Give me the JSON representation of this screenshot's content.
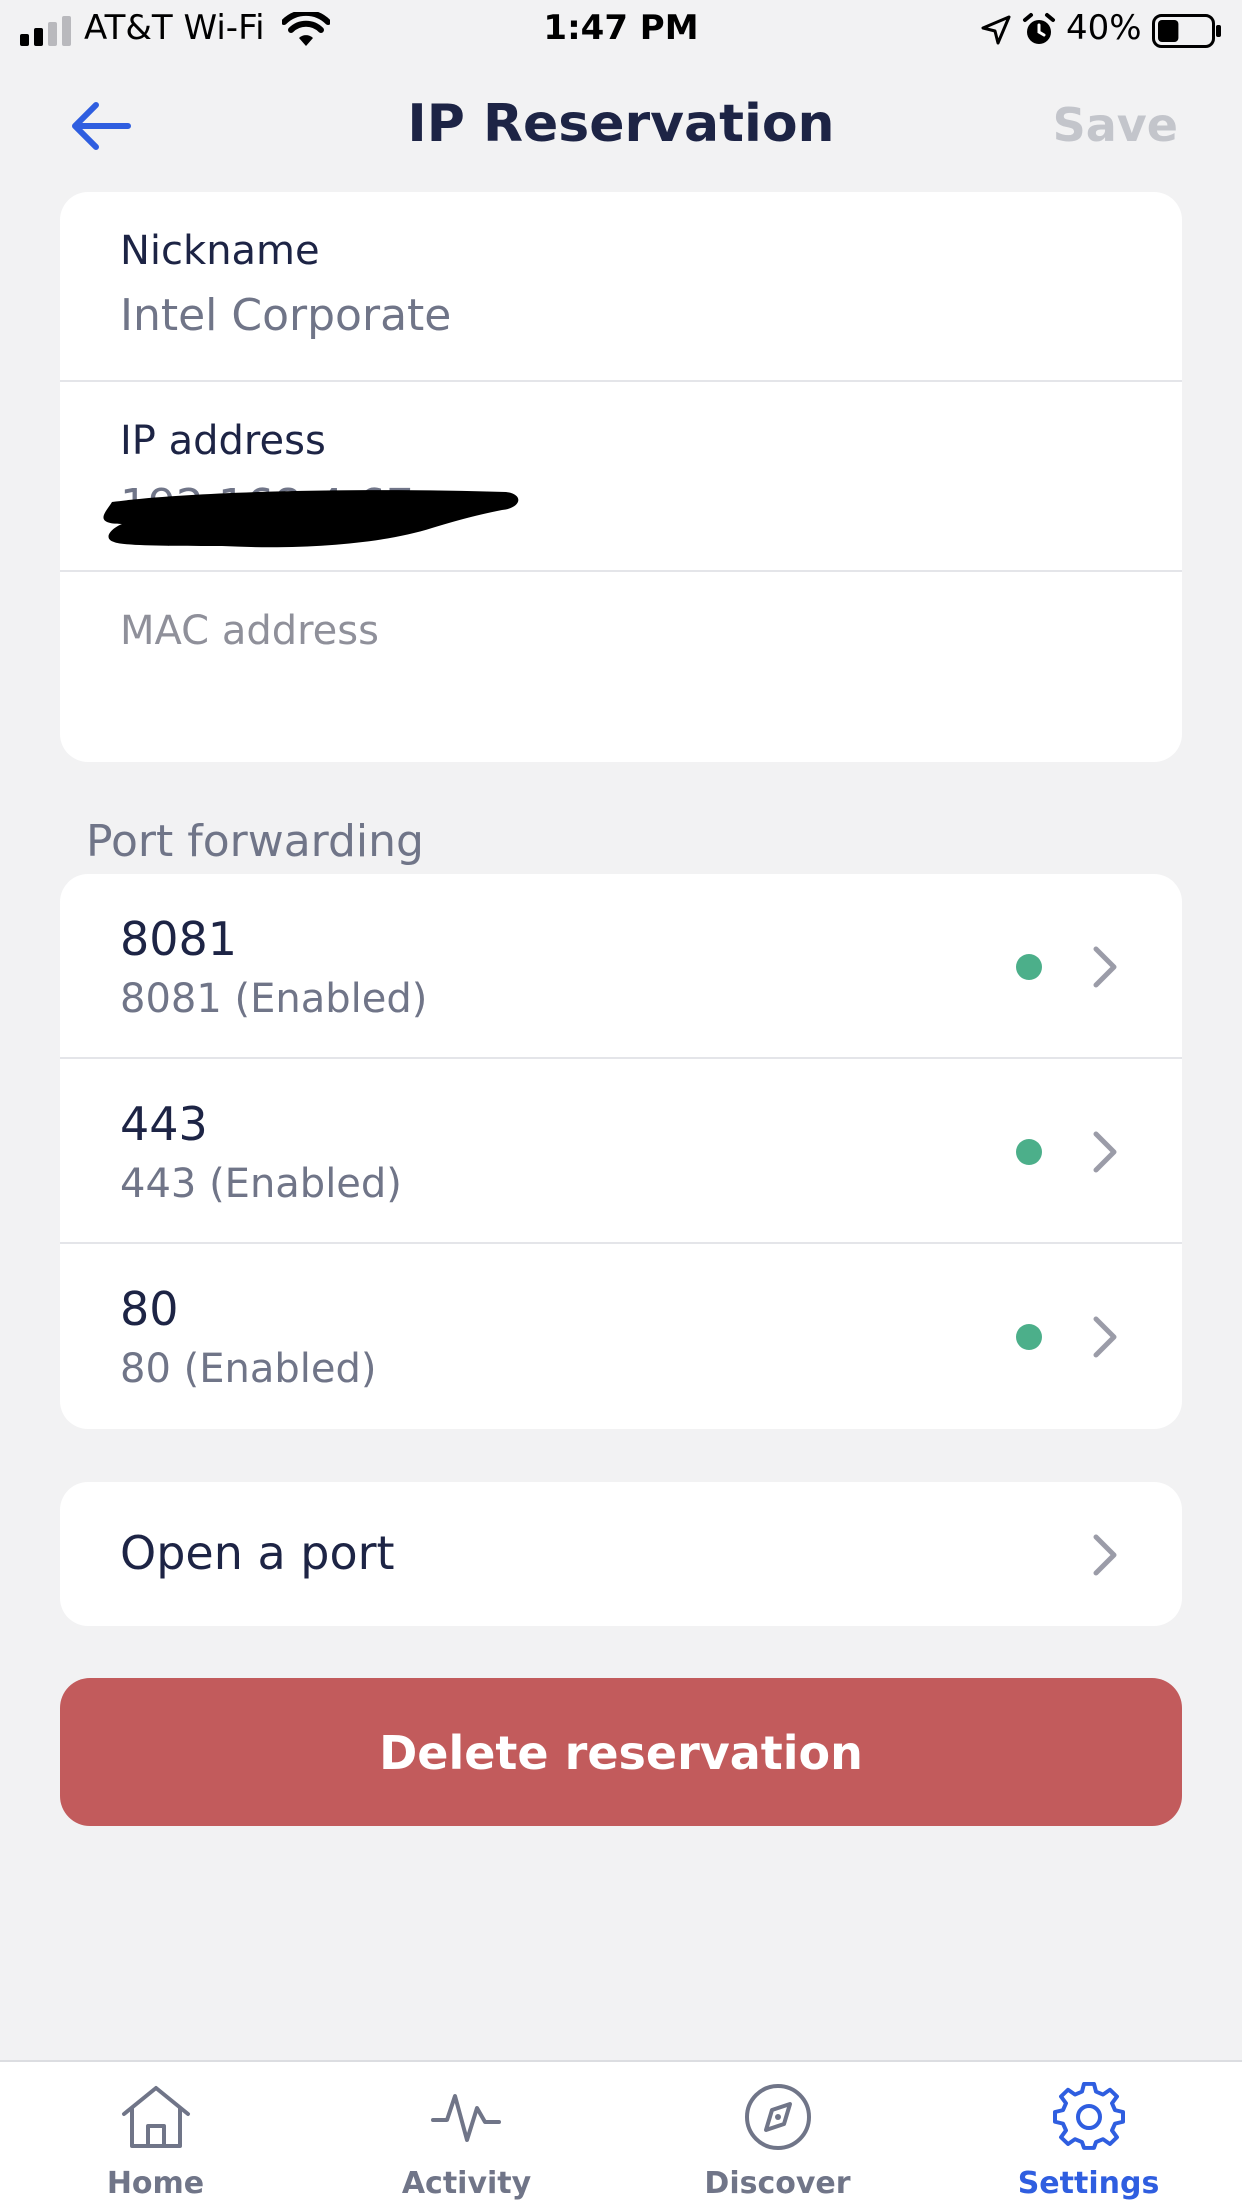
{
  "status_bar": {
    "carrier": "AT&T Wi-Fi",
    "time": "1:47 PM",
    "battery": "40%",
    "battery_level": 0.4
  },
  "nav": {
    "title": "IP Reservation",
    "save_label": "Save",
    "back_icon": "arrow-left-icon"
  },
  "details": {
    "nickname_label": "Nickname",
    "nickname_value": "Intel Corporate",
    "ip_label": "IP address",
    "ip_value": "192.168.4.67",
    "mac_label": "MAC address",
    "mac_value": "redacted"
  },
  "port_forwarding": {
    "header": "Port forwarding",
    "items": [
      {
        "title": "8081",
        "subtitle": "8081 (Enabled)"
      },
      {
        "title": "443",
        "subtitle": "443 (Enabled)"
      },
      {
        "title": "80",
        "subtitle": "80 (Enabled)"
      }
    ]
  },
  "open_port": {
    "label": "Open a port"
  },
  "delete_label": "Delete reservation",
  "tabs": [
    {
      "label": "Home",
      "icon": "home-icon"
    },
    {
      "label": "Activity",
      "icon": "activity-icon"
    },
    {
      "label": "Discover",
      "icon": "compass-icon"
    },
    {
      "label": "Settings",
      "icon": "gear-icon",
      "active": true
    }
  ],
  "colors": {
    "accent": "#2f5ee0",
    "enabled_dot": "#4caf8a",
    "delete_button": "#c25b5c",
    "title_text": "#1d2445",
    "muted_text": "#707588",
    "background": "#f2f2f3"
  }
}
